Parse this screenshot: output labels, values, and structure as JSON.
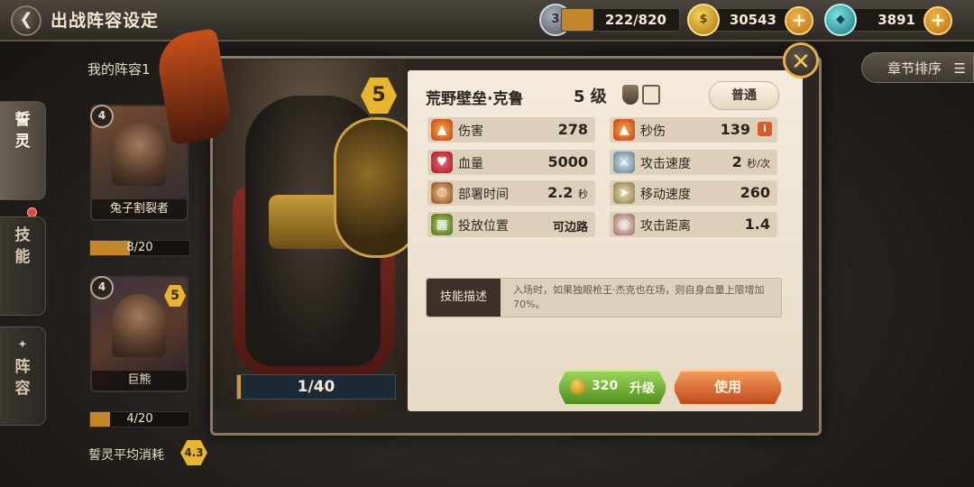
{
  "header": {
    "back_icon": "back-arrow-icon",
    "title": "出战阵容设定"
  },
  "resources": {
    "stamina": {
      "icon_text": "3",
      "value": "222/820",
      "fill": 0.27
    },
    "gold": {
      "value": "30543"
    },
    "gems": {
      "value": "3891"
    }
  },
  "sidebar": {
    "tabs": [
      {
        "label_1": "誓",
        "label_2": "灵",
        "active": true
      },
      {
        "label_1": "技",
        "label_2": "能",
        "active": false
      },
      {
        "label_1": "阵",
        "label_2": "容",
        "active": false
      }
    ]
  },
  "lineup": {
    "title": "我的阵容1",
    "cards": [
      {
        "name": "兔子割裂者",
        "cost": "4",
        "progress": "8/20",
        "fill": 0.4
      },
      {
        "name": "巨熊",
        "cost": "4",
        "level": "5",
        "progress": "4/20",
        "fill": 0.2
      }
    ],
    "avg_label": "誓灵平均消耗",
    "avg_value": "4.3"
  },
  "sort_button": {
    "label": "章节排序",
    "icon": "list-icon"
  },
  "popup": {
    "hero_level_badge": "5",
    "shards": {
      "text": "1/40",
      "fill": 0.025
    },
    "name": "荒野壁垒·克鲁",
    "level_text": "5 级",
    "rarity": "普通",
    "stats": {
      "damage": {
        "label": "伤害",
        "value": "278"
      },
      "dps": {
        "label": "秒伤",
        "value": "139"
      },
      "hp": {
        "label": "血量",
        "value": "5000"
      },
      "attack_speed": {
        "label": "攻击速度",
        "value": "2",
        "unit": "秒/次"
      },
      "deploy_time": {
        "label": "部署时间",
        "value": "2.2",
        "unit": "秒"
      },
      "move_speed": {
        "label": "移动速度",
        "value": "260"
      },
      "placement": {
        "label": "投放位置",
        "value": "可边路"
      },
      "range": {
        "label": "攻击距离",
        "value": "1.4"
      }
    },
    "skill": {
      "label": "技能描述",
      "text": "入场时，如果独眼枪王·杰克也在场，则自身血量上限增加70%。"
    },
    "upgrade": {
      "cost": "320",
      "label": "升级"
    },
    "use_label": "使用",
    "close_icon": "close-x-icon"
  },
  "colors": {
    "accent_gold": "#e7b52f",
    "upgrade_green": "#6aae2c",
    "use_orange": "#d9622a"
  }
}
